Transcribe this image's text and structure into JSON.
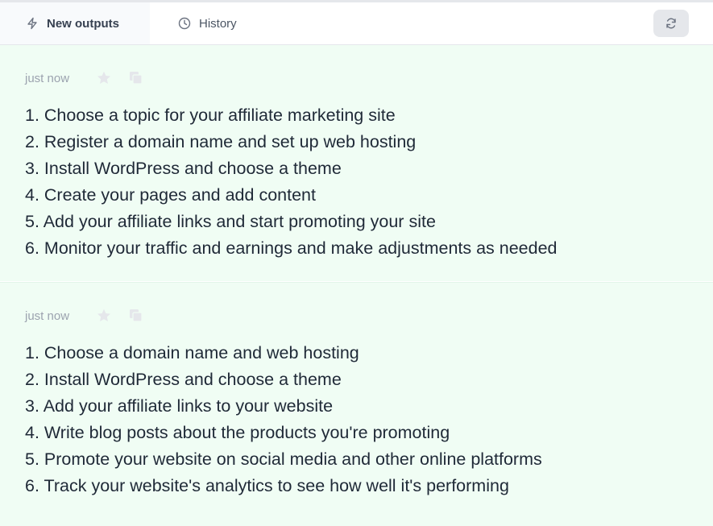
{
  "tabs": {
    "new_outputs": "New outputs",
    "history": "History"
  },
  "outputs": [
    {
      "time": "just now",
      "lines": [
        "1. Choose a topic for your affiliate marketing site",
        "2. Register a domain name and set up web hosting",
        "3. Install WordPress and choose a theme",
        "4. Create your pages and add content",
        "5. Add your affiliate links and start promoting your site",
        "6. Monitor your traffic and earnings and make adjustments as needed"
      ]
    },
    {
      "time": "just now",
      "lines": [
        "1. Choose a domain name and web hosting",
        "2. Install WordPress and choose a theme",
        "3. Add your affiliate links to your website",
        "4. Write blog posts about the products you're promoting",
        "5. Promote your website on social media and other online platforms",
        "6. Track your website's analytics to see how well it's performing"
      ]
    }
  ],
  "icons": {
    "new_outputs": "lightning-icon",
    "history": "clock-icon",
    "refresh": "refresh-icon",
    "favorite": "star-icon",
    "copy": "copy-icon"
  },
  "colors": {
    "output_background": "#f0fdf4",
    "text": "#1f2937",
    "muted": "#9ca3af",
    "icon_muted": "#e5e7eb"
  }
}
